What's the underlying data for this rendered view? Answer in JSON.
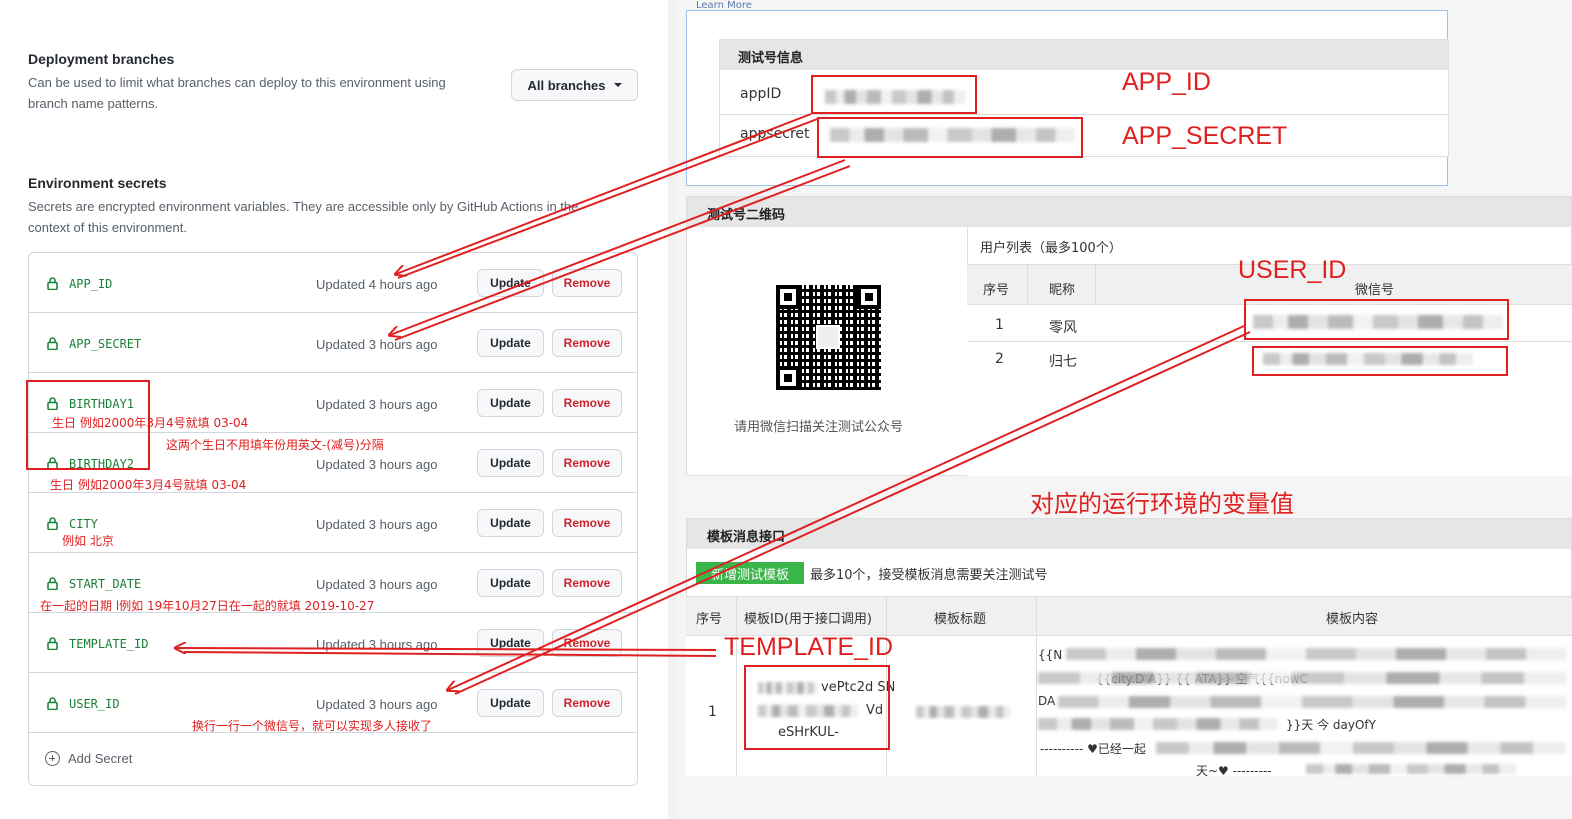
{
  "left": {
    "deployment": {
      "title": "Deployment branches",
      "desc1": "Can be used to limit what branches can deploy to this environment using",
      "desc2": "branch name patterns.",
      "branch_button": "All branches"
    },
    "secrets_section": {
      "title": "Environment secrets",
      "desc1": "Secrets are encrypted environment variables. They are accessible only by GitHub Actions in the",
      "desc2": "context of this environment.",
      "update_label": "Update",
      "remove_label": "Remove",
      "add_label": "Add Secret",
      "rows": [
        {
          "name": "APP_ID",
          "updated": "Updated 4 hours ago"
        },
        {
          "name": "APP_SECRET",
          "updated": "Updated 3 hours ago"
        },
        {
          "name": "BIRTHDAY1",
          "updated": "Updated 3 hours ago"
        },
        {
          "name": "BIRTHDAY2",
          "updated": "Updated 3 hours ago"
        },
        {
          "name": "CITY",
          "updated": "Updated 3 hours ago"
        },
        {
          "name": "START_DATE",
          "updated": "Updated 3 hours ago"
        },
        {
          "name": "TEMPLATE_ID",
          "updated": "Updated 3 hours ago"
        },
        {
          "name": "USER_ID",
          "updated": "Updated 3 hours ago"
        }
      ]
    },
    "notes": {
      "birthday1": "生日  例如2000年3月4号就填     03-04",
      "birthday_sep": "这两个生日不用填年份用英文-(减号)分隔",
      "birthday2": "生日  例如2000年3月4号就填     03-04",
      "city": "例如  北京",
      "start_date": "在一起的日期 l例如 19年10月27日在一起的就填  2019-10-27",
      "user_id": "换行一行一个微信号，就可以实现多人接收了"
    }
  },
  "right": {
    "learn_more": "Learn More",
    "info_panel": {
      "title": "测试号信息",
      "appid_label": "appID",
      "appsecret_label": "appsecret"
    },
    "qr_panel": {
      "title": "测试号二维码",
      "qr_caption": "请用微信扫描关注测试公众号",
      "user_list_title": "用户列表（最多100个）",
      "col_no": "序号",
      "col_nick": "昵称",
      "col_wx": "微信号",
      "users": [
        {
          "no": "1",
          "nick": "零风"
        },
        {
          "no": "2",
          "nick": "归七"
        }
      ]
    },
    "template_panel": {
      "title": "模板消息接口",
      "add_button": "新增测试模板",
      "hint": "最多10个，接受模板消息需要关注测试号",
      "col_no": "序号",
      "col_id": "模板ID(用于接口调用)",
      "col_title": "模板标题",
      "col_content": "模板内容",
      "row_no": "1",
      "id_line1": "vePtc2d SN",
      "id_line2": "Vd",
      "id_line3": "eSHrKUL-",
      "content_line1": "{{N",
      "content_line2": "{{city.D   A}} {{   ATA}} 空气{{nowC",
      "content_line3": "DA",
      "content_line4": "}}天 今  dayOfY",
      "content_line5": "---------- ♥已经一起",
      "content_line6": "天~♥ ---------"
    },
    "annotations": {
      "app_id": "APP_ID",
      "app_secret": "APP_SECRET",
      "user_id": "USER_ID",
      "template_id": "TEMPLATE_ID",
      "env_values": "对应的运行环境的变量值"
    }
  },
  "colors": {
    "accent_red": "#e02020",
    "secret_green": "#1a7f37",
    "remove_red": "#cf222e",
    "wechat_green": "#3ab54a"
  }
}
